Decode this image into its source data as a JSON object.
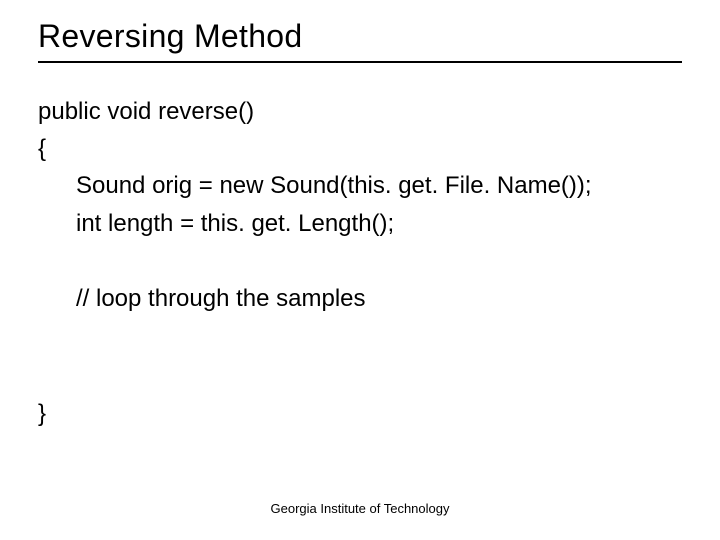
{
  "title": "Reversing Method",
  "code": {
    "line1": "public void reverse()",
    "line2": "{",
    "line3": "Sound orig = new Sound(this. get. File. Name());",
    "line4": "int length = this. get. Length();",
    "line5": "// loop through the samples",
    "line6": "}"
  },
  "footer": "Georgia Institute of Technology"
}
